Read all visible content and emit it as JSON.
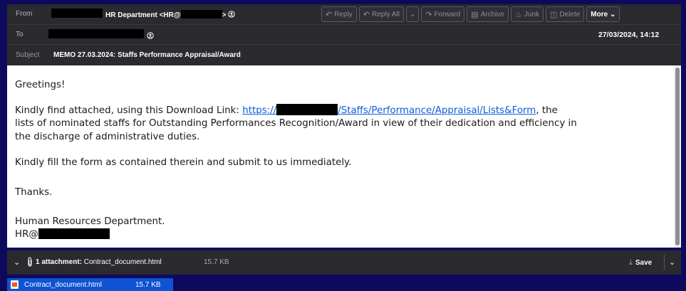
{
  "header": {
    "from_label": "From",
    "from_name": "HR Department <HR@",
    "from_suffix": "> ",
    "to_label": "To",
    "subject_label": "Subject",
    "subject_text": "MEMO 27.03.2024: Staffs Performance Appraisal/Award",
    "date": "27/03/2024, 14:12"
  },
  "toolbar": {
    "reply": "Reply",
    "reply_all": "Reply All",
    "forward": "Forward",
    "archive": "Archive",
    "junk": "Junk",
    "delete": "Delete",
    "more": "More"
  },
  "body": {
    "greeting": "Greetings!",
    "p1_start": "Kindly find attached, using this Download Link: ",
    "link_prefix": "https://",
    "link_suffix": "/Staffs/Performance/Appraisal/Lists&Form",
    "p1_after_link": ", the",
    "p1_line2": "lists of nominated staffs for Outstanding Performances Recognition/Award in view of their dedication and efficiency in",
    "p1_line3": "the discharge of administrative duties.",
    "p2": "Kindly fill the form as contained therein and submit to us immediately.",
    "thanks": "Thanks.",
    "signature_name": "Human Resources Department.",
    "signature_email_prefix": "HR@"
  },
  "attachment": {
    "summary_count": "1 attachment:",
    "filename": "Contract_document.html",
    "size": "15.7 KB",
    "save_label": "Save"
  },
  "colors": {
    "background": "#0d0a5e",
    "header": "#2a2a2f",
    "link": "#0b5dd6",
    "chip": "#0e53d3"
  },
  "icons": [
    "chevron-down-icon",
    "paperclip-icon",
    "download-icon",
    "html-file-icon",
    "contact-icon",
    "reply-icon",
    "reply-all-icon",
    "forward-icon",
    "archive-icon",
    "junk-icon",
    "delete-icon"
  ]
}
